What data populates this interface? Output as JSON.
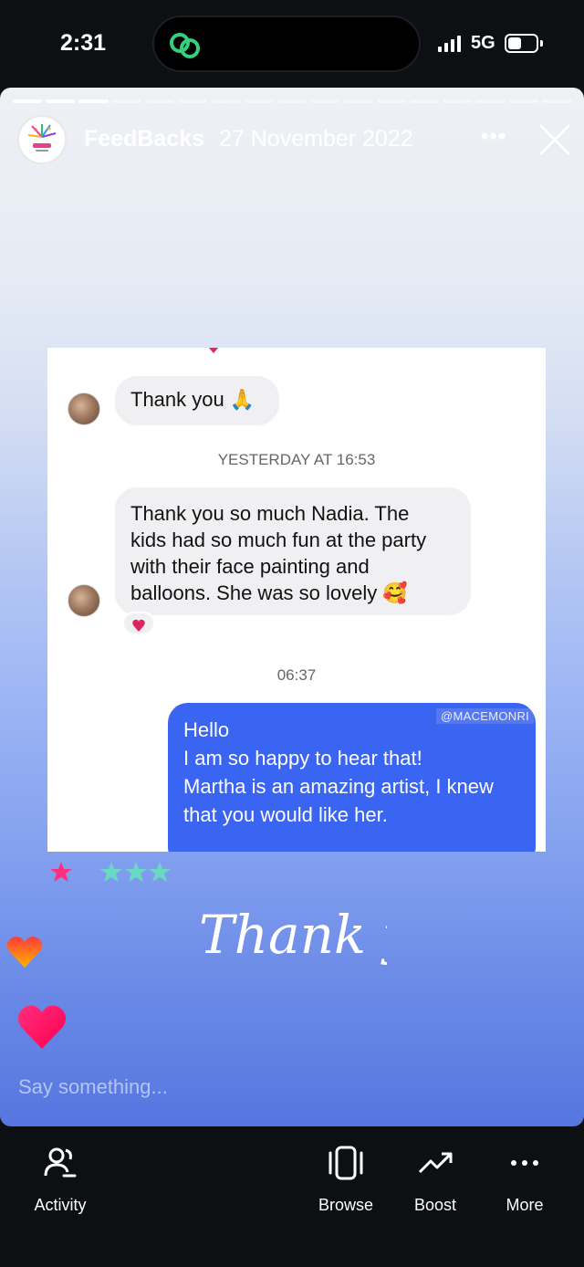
{
  "status_bar": {
    "time": "2:31",
    "network": "5G",
    "icons": [
      "linked-rings-icon",
      "signal-icon",
      "battery-icon"
    ]
  },
  "story": {
    "username": "FeedBacks",
    "date": "27 November 2022",
    "more_glyph": "•••",
    "segments_total": 17,
    "segments_completed": 3,
    "reply_placeholder": "Say something...",
    "overlay_icons": [
      "star-icon",
      "heart-icon"
    ],
    "colors": {
      "pink_accent": "#ff2e7e",
      "teal_star": "#6ad8c2",
      "bubble_blue": "#3a64f2"
    }
  },
  "chat": {
    "messages": [
      {
        "from": "them",
        "text": "Thank you 🙏"
      },
      {
        "timestamp": "YESTERDAY AT 16:53"
      },
      {
        "from": "them",
        "lines": [
          "Thank you so much Nadia. The",
          "kids had so much fun at the party",
          "with their face painting and",
          "balloons. She was so lovely 🥰"
        ],
        "reaction": "❤️"
      },
      {
        "timestamp": "06:37"
      },
      {
        "from": "me",
        "lines": [
          "Hello",
          "I am so happy to hear that!",
          "Martha is an amazing artist, I knew",
          "that you would like her."
        ]
      }
    ],
    "watermark": "@MACEMONRI"
  },
  "overlay": {
    "handwritten_text": "Thank you"
  },
  "bottom_nav": [
    {
      "label": "Activity",
      "icon": "people-icon"
    },
    {
      "label": "Browse",
      "icon": "carousel-icon"
    },
    {
      "label": "Boost",
      "icon": "trend-up-icon"
    },
    {
      "label": "More",
      "icon": "more-dots-icon"
    }
  ]
}
